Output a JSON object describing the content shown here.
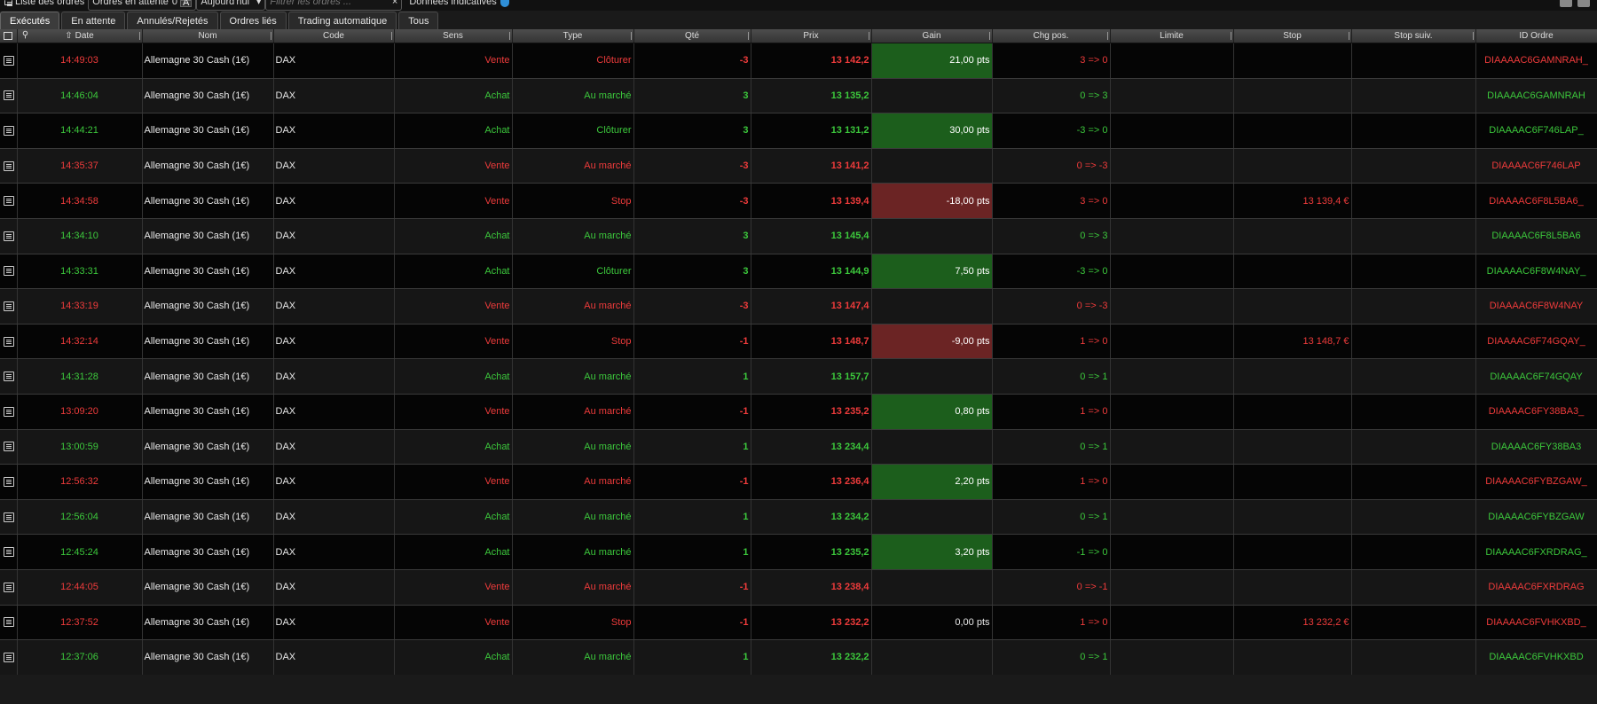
{
  "topbar": {
    "title": "Liste des ordres",
    "pending_label": "Ordres en attente",
    "pending_count": "0",
    "pending_indicator": "A",
    "period": "Aujourd'hui",
    "filter_placeholder": "Filtrer les ordres ...",
    "clear": "×",
    "data_label": "Données indicatives"
  },
  "tabs": [
    {
      "label": "Exécutés"
    },
    {
      "label": "En attente"
    },
    {
      "label": "Annulés/Rejetés"
    },
    {
      "label": "Ordres liés"
    },
    {
      "label": "Trading automatique"
    },
    {
      "label": "Tous"
    }
  ],
  "columns": {
    "date": "Date",
    "nom": "Nom",
    "code": "Code",
    "sens": "Sens",
    "type": "Type",
    "qte": "Qté",
    "prix": "Prix",
    "gain": "Gain",
    "chg": "Chg pos.",
    "limite": "Limite",
    "stop": "Stop",
    "stop_suiv": "Stop suiv.",
    "id": "ID Ordre"
  },
  "colors": {
    "buy": "#3cc83c",
    "sell": "#ee3b3b",
    "gain_pos": "#1c5e1c",
    "gain_neg": "#6b2424"
  },
  "rows": [
    {
      "time": "14:49:03",
      "name": "Allemagne 30 Cash (1€)",
      "code": "DAX",
      "side": "Vente",
      "type": "Clôturer",
      "qty": "-3",
      "price": "13 142,2",
      "gain": "21,00 pts",
      "gain_state": "pos",
      "chg": "3 => 0",
      "limite": "",
      "stop": "",
      "stop_suiv": "",
      "id": "DIAAAAC6GAMNRAH_",
      "dir": "sell"
    },
    {
      "time": "14:46:04",
      "name": "Allemagne 30 Cash (1€)",
      "code": "DAX",
      "side": "Achat",
      "type": "Au marché",
      "qty": "3",
      "price": "13 135,2",
      "gain": "",
      "gain_state": "none",
      "chg": "0 => 3",
      "limite": "",
      "stop": "",
      "stop_suiv": "",
      "id": "DIAAAAC6GAMNRAH",
      "dir": "buy"
    },
    {
      "time": "14:44:21",
      "name": "Allemagne 30 Cash (1€)",
      "code": "DAX",
      "side": "Achat",
      "type": "Clôturer",
      "qty": "3",
      "price": "13 131,2",
      "gain": "30,00 pts",
      "gain_state": "pos",
      "chg": "-3 => 0",
      "limite": "",
      "stop": "",
      "stop_suiv": "",
      "id": "DIAAAAC6F746LAP_",
      "dir": "buy"
    },
    {
      "time": "14:35:37",
      "name": "Allemagne 30 Cash (1€)",
      "code": "DAX",
      "side": "Vente",
      "type": "Au marché",
      "qty": "-3",
      "price": "13 141,2",
      "gain": "",
      "gain_state": "none",
      "chg": "0 => -3",
      "limite": "",
      "stop": "",
      "stop_suiv": "",
      "id": "DIAAAAC6F746LAP",
      "dir": "sell"
    },
    {
      "time": "14:34:58",
      "name": "Allemagne 30 Cash (1€)",
      "code": "DAX",
      "side": "Vente",
      "type": "Stop",
      "qty": "-3",
      "price": "13 139,4",
      "gain": "-18,00 pts",
      "gain_state": "neg",
      "chg": "3 => 0",
      "limite": "",
      "stop": "13 139,4 €",
      "stop_suiv": "",
      "id": "DIAAAAC6F8L5BA6_",
      "dir": "sell"
    },
    {
      "time": "14:34:10",
      "name": "Allemagne 30 Cash (1€)",
      "code": "DAX",
      "side": "Achat",
      "type": "Au marché",
      "qty": "3",
      "price": "13 145,4",
      "gain": "",
      "gain_state": "none",
      "chg": "0 => 3",
      "limite": "",
      "stop": "",
      "stop_suiv": "",
      "id": "DIAAAAC6F8L5BA6",
      "dir": "buy"
    },
    {
      "time": "14:33:31",
      "name": "Allemagne 30 Cash (1€)",
      "code": "DAX",
      "side": "Achat",
      "type": "Clôturer",
      "qty": "3",
      "price": "13 144,9",
      "gain": "7,50 pts",
      "gain_state": "pos",
      "chg": "-3 => 0",
      "limite": "",
      "stop": "",
      "stop_suiv": "",
      "id": "DIAAAAC6F8W4NAY_",
      "dir": "buy"
    },
    {
      "time": "14:33:19",
      "name": "Allemagne 30 Cash (1€)",
      "code": "DAX",
      "side": "Vente",
      "type": "Au marché",
      "qty": "-3",
      "price": "13 147,4",
      "gain": "",
      "gain_state": "none",
      "chg": "0 => -3",
      "limite": "",
      "stop": "",
      "stop_suiv": "",
      "id": "DIAAAAC6F8W4NAY",
      "dir": "sell"
    },
    {
      "time": "14:32:14",
      "name": "Allemagne 30 Cash (1€)",
      "code": "DAX",
      "side": "Vente",
      "type": "Stop",
      "qty": "-1",
      "price": "13 148,7",
      "gain": "-9,00 pts",
      "gain_state": "neg",
      "chg": "1 => 0",
      "limite": "",
      "stop": "13 148,7 €",
      "stop_suiv": "",
      "id": "DIAAAAC6F74GQAY_",
      "dir": "sell"
    },
    {
      "time": "14:31:28",
      "name": "Allemagne 30 Cash (1€)",
      "code": "DAX",
      "side": "Achat",
      "type": "Au marché",
      "qty": "1",
      "price": "13 157,7",
      "gain": "",
      "gain_state": "none",
      "chg": "0 => 1",
      "limite": "",
      "stop": "",
      "stop_suiv": "",
      "id": "DIAAAAC6F74GQAY",
      "dir": "buy"
    },
    {
      "time": "13:09:20",
      "name": "Allemagne 30 Cash (1€)",
      "code": "DAX",
      "side": "Vente",
      "type": "Au marché",
      "qty": "-1",
      "price": "13 235,2",
      "gain": "0,80 pts",
      "gain_state": "pos",
      "chg": "1 => 0",
      "limite": "",
      "stop": "",
      "stop_suiv": "",
      "id": "DIAAAAC6FY38BA3_",
      "dir": "sell"
    },
    {
      "time": "13:00:59",
      "name": "Allemagne 30 Cash (1€)",
      "code": "DAX",
      "side": "Achat",
      "type": "Au marché",
      "qty": "1",
      "price": "13 234,4",
      "gain": "",
      "gain_state": "none",
      "chg": "0 => 1",
      "limite": "",
      "stop": "",
      "stop_suiv": "",
      "id": "DIAAAAC6FY38BA3",
      "dir": "buy"
    },
    {
      "time": "12:56:32",
      "name": "Allemagne 30 Cash (1€)",
      "code": "DAX",
      "side": "Vente",
      "type": "Au marché",
      "qty": "-1",
      "price": "13 236,4",
      "gain": "2,20 pts",
      "gain_state": "pos",
      "chg": "1 => 0",
      "limite": "",
      "stop": "",
      "stop_suiv": "",
      "id": "DIAAAAC6FYBZGAW_",
      "dir": "sell"
    },
    {
      "time": "12:56:04",
      "name": "Allemagne 30 Cash (1€)",
      "code": "DAX",
      "side": "Achat",
      "type": "Au marché",
      "qty": "1",
      "price": "13 234,2",
      "gain": "",
      "gain_state": "none",
      "chg": "0 => 1",
      "limite": "",
      "stop": "",
      "stop_suiv": "",
      "id": "DIAAAAC6FYBZGAW",
      "dir": "buy"
    },
    {
      "time": "12:45:24",
      "name": "Allemagne 30 Cash (1€)",
      "code": "DAX",
      "side": "Achat",
      "type": "Au marché",
      "qty": "1",
      "price": "13 235,2",
      "gain": "3,20 pts",
      "gain_state": "pos",
      "chg": "-1 => 0",
      "limite": "",
      "stop": "",
      "stop_suiv": "",
      "id": "DIAAAAC6FXRDRAG_",
      "dir": "buy"
    },
    {
      "time": "12:44:05",
      "name": "Allemagne 30 Cash (1€)",
      "code": "DAX",
      "side": "Vente",
      "type": "Au marché",
      "qty": "-1",
      "price": "13 238,4",
      "gain": "",
      "gain_state": "none",
      "chg": "0 => -1",
      "limite": "",
      "stop": "",
      "stop_suiv": "",
      "id": "DIAAAAC6FXRDRAG",
      "dir": "sell"
    },
    {
      "time": "12:37:52",
      "name": "Allemagne 30 Cash (1€)",
      "code": "DAX",
      "side": "Vente",
      "type": "Stop",
      "qty": "-1",
      "price": "13 232,2",
      "gain": "0,00 pts",
      "gain_state": "zero",
      "chg": "1 => 0",
      "limite": "",
      "stop": "13 232,2 €",
      "stop_suiv": "",
      "id": "DIAAAAC6FVHKXBD_",
      "dir": "sell"
    },
    {
      "time": "12:37:06",
      "name": "Allemagne 30 Cash (1€)",
      "code": "DAX",
      "side": "Achat",
      "type": "Au marché",
      "qty": "1",
      "price": "13 232,2",
      "gain": "",
      "gain_state": "none",
      "chg": "0 => 1",
      "limite": "",
      "stop": "",
      "stop_suiv": "",
      "id": "DIAAAAC6FVHKXBD",
      "dir": "buy"
    }
  ]
}
